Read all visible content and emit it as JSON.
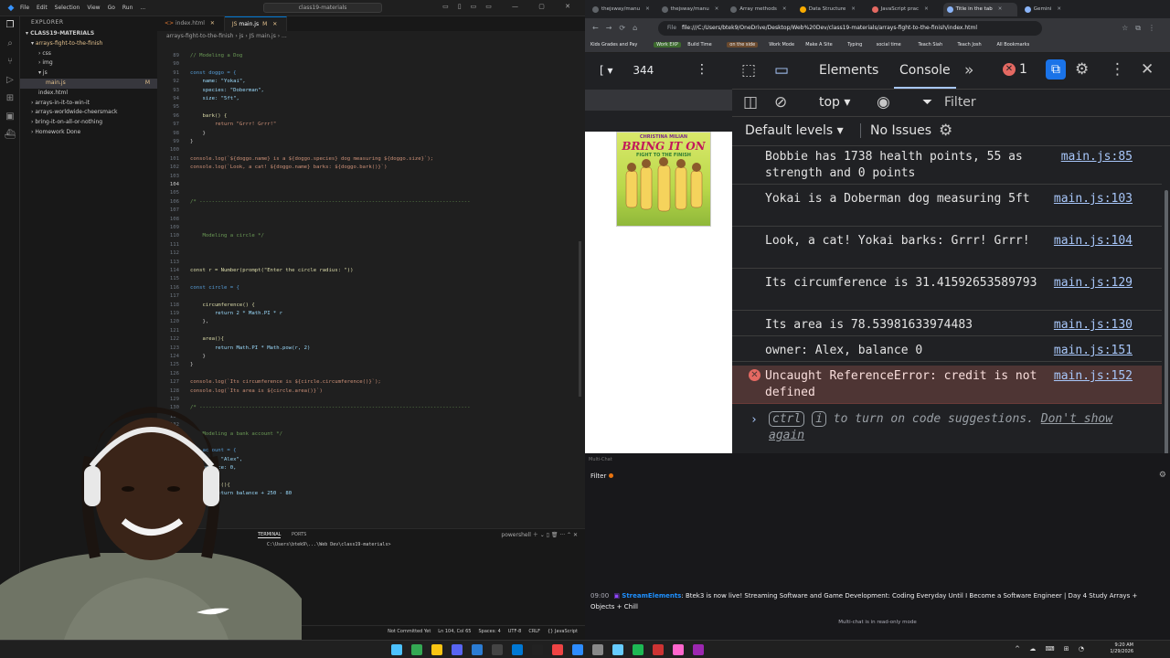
{
  "vscode": {
    "menu": [
      "File",
      "Edit",
      "Selection",
      "View",
      "Go",
      "Run",
      "..."
    ],
    "search": "class19-materials",
    "explorer_title": "EXPLORER",
    "root_folder": "CLASS19-MATERIALS",
    "tree": [
      {
        "label": "arrays-fight-to-the-finish",
        "indent": 1,
        "icon": "▾",
        "color": "#e2c08d"
      },
      {
        "label": "css",
        "indent": 2,
        "icon": "›",
        "color": "#ccc"
      },
      {
        "label": "img",
        "indent": 2,
        "icon": "›",
        "color": "#ccc"
      },
      {
        "label": "js",
        "indent": 2,
        "icon": "▾",
        "color": "#ccc"
      },
      {
        "label": "main.js",
        "indent": 3,
        "icon": "",
        "color": "#e2c08d",
        "selected": true,
        "mark": "M"
      },
      {
        "label": "index.html",
        "indent": 2,
        "icon": "",
        "color": "#ccc"
      },
      {
        "label": "arrays-in-it-to-win-it",
        "indent": 1,
        "icon": "›",
        "color": "#ccc"
      },
      {
        "label": "arrays-worldwide-cheersmack",
        "indent": 1,
        "icon": "›",
        "color": "#ccc"
      },
      {
        "label": "bring-it-on-all-or-nothing",
        "indent": 1,
        "icon": "›",
        "color": "#ccc"
      },
      {
        "label": "Homework Done",
        "indent": 1,
        "icon": "›",
        "color": "#ccc"
      }
    ],
    "tabs": [
      {
        "label": "index.html",
        "active": false,
        "mark": ""
      },
      {
        "label": "main.js",
        "active": true,
        "mark": "M"
      }
    ],
    "breadcrumb": "arrays-fight-to-the-finish › js › JS main.js › ...",
    "code": [
      {
        "n": "89",
        "t": "// Modeling a Dog",
        "c": "c-comment"
      },
      {
        "n": "90",
        "t": "",
        "c": ""
      },
      {
        "n": "91",
        "t": "const doggo = {",
        "c": "c-kw"
      },
      {
        "n": "92",
        "t": "    name: \"Yokai\",",
        "c": "c-prop"
      },
      {
        "n": "93",
        "t": "    species: \"Doberman\",",
        "c": "c-prop"
      },
      {
        "n": "94",
        "t": "    size: \"5ft\",",
        "c": "c-prop"
      },
      {
        "n": "95",
        "t": "",
        "c": ""
      },
      {
        "n": "96",
        "t": "    bark() {",
        "c": "c-fn"
      },
      {
        "n": "97",
        "t": "        return \"Grrr! Grrr!\"",
        "c": "c-str"
      },
      {
        "n": "98",
        "t": "    }",
        "c": ""
      },
      {
        "n": "99",
        "t": "}",
        "c": ""
      },
      {
        "n": "100",
        "t": "",
        "c": ""
      },
      {
        "n": "101",
        "t": "console.log(`${doggo.name} is a ${doggo.species} dog measuring ${doggo.size}`);",
        "c": "c-str"
      },
      {
        "n": "102",
        "t": "console.log(`Look, a cat! ${doggo.name} barks: ${doggo.bark()}`)",
        "c": "c-str"
      },
      {
        "n": "103",
        "t": "",
        "c": ""
      },
      {
        "n": "104",
        "t": "",
        "c": ""
      },
      {
        "n": "105",
        "t": "",
        "c": ""
      },
      {
        "n": "106",
        "t": "/* ----------------------------------------------------------------------------------------",
        "c": "c-comment"
      },
      {
        "n": "107",
        "t": "",
        "c": ""
      },
      {
        "n": "108",
        "t": "",
        "c": ""
      },
      {
        "n": "109",
        "t": "",
        "c": ""
      },
      {
        "n": "110",
        "t": "    Modeling a circle */",
        "c": "c-comment"
      },
      {
        "n": "111",
        "t": "",
        "c": ""
      },
      {
        "n": "112",
        "t": "",
        "c": ""
      },
      {
        "n": "113",
        "t": "",
        "c": ""
      },
      {
        "n": "114",
        "t": "const r = Number(prompt(\"Enter the circle radius: \"))",
        "c": "c-fn"
      },
      {
        "n": "115",
        "t": "",
        "c": ""
      },
      {
        "n": "116",
        "t": "const circle = {",
        "c": "c-kw"
      },
      {
        "n": "117",
        "t": "",
        "c": ""
      },
      {
        "n": "118",
        "t": "    circumference() {",
        "c": "c-fn"
      },
      {
        "n": "119",
        "t": "        return 2 * Math.PI * r",
        "c": "c-prop"
      },
      {
        "n": "120",
        "t": "    },",
        "c": ""
      },
      {
        "n": "121",
        "t": "",
        "c": ""
      },
      {
        "n": "122",
        "t": "    area(){",
        "c": "c-fn"
      },
      {
        "n": "123",
        "t": "        return Math.PI * Math.pow(r, 2)",
        "c": "c-prop"
      },
      {
        "n": "124",
        "t": "    }",
        "c": ""
      },
      {
        "n": "125",
        "t": "}",
        "c": ""
      },
      {
        "n": "126",
        "t": "",
        "c": ""
      },
      {
        "n": "127",
        "t": "console.log(`Its circumference is ${circle.circumference()}`);",
        "c": "c-str"
      },
      {
        "n": "128",
        "t": "console.log(`Its area is ${circle.area()}`)",
        "c": "c-str"
      },
      {
        "n": "129",
        "t": "",
        "c": ""
      },
      {
        "n": "130",
        "t": "/* ----------------------------------------------------------------------------------------",
        "c": "c-comment"
      },
      {
        "n": "131",
        "t": "",
        "c": ""
      },
      {
        "n": "132",
        "t": "",
        "c": ""
      },
      {
        "n": "133",
        "t": "    Modeling a bank account */",
        "c": "c-comment"
      },
      {
        "n": "134",
        "t": "",
        "c": ""
      },
      {
        "n": "135",
        "t": "    account = {",
        "c": "c-kw"
      },
      {
        "n": "136",
        "t": "    name: \"Alex\",",
        "c": "c-prop"
      },
      {
        "n": "137",
        "t": "    balance: 0,",
        "c": "c-prop"
      },
      {
        "n": "138",
        "t": "",
        "c": ""
      },
      {
        "n": "139",
        "t": "    credit(){",
        "c": "c-fn"
      },
      {
        "n": "140",
        "t": "        return balance + 250 - 80",
        "c": "c-prop"
      }
    ],
    "panel_tabs": [
      "TERMINAL",
      "PORTS"
    ],
    "panel_shell": "powershell",
    "terminal_line": "C:\\Users\\btek9\\...\\Web Dev\\class19-materials>",
    "status_right": [
      "Not Committed Yet",
      "Ln 104, Col 65",
      "Spaces: 4",
      "UTF-8",
      "CRLF",
      "{} JavaScript"
    ]
  },
  "chrome": {
    "tabs": [
      {
        "label": "thejsway/manu",
        "color": "#5f6368"
      },
      {
        "label": "thejsway/manu",
        "color": "#5f6368"
      },
      {
        "label": "Array methods",
        "color": "#5f6368"
      },
      {
        "label": "Data Structure",
        "color": "#f9ab00"
      },
      {
        "label": "JavaScript prac",
        "color": "#e46962"
      },
      {
        "label": "Title in the tab",
        "color": "#8ab4f8",
        "active": true
      },
      {
        "label": "Gemini",
        "color": "#8ab4f8"
      }
    ],
    "url_scheme": "File",
    "url": "file:///C:/Users/btek9/OneDrive/Desktop/Web%20Dev/class19-materials/arrays-fight-to-the-finish/index.html",
    "bookmarks": [
      {
        "label": "Kids Grades and Pay",
        "style": ""
      },
      {
        "label": "Work EXP",
        "style": "hl"
      },
      {
        "label": "Build Time",
        "style": ""
      },
      {
        "label": "on the side",
        "style": "hl2"
      },
      {
        "label": "Work Mode",
        "style": ""
      },
      {
        "label": "Make A Site",
        "style": ""
      },
      {
        "label": "Typing",
        "style": ""
      },
      {
        "label": "social time",
        "style": ""
      },
      {
        "label": "Teach Siah",
        "style": ""
      },
      {
        "label": "Teach Josh",
        "style": ""
      },
      {
        "label": "All Bookmarks",
        "style": ""
      }
    ],
    "viewport_width": "344",
    "poster": {
      "line1": "CHRISTINA MILIAN",
      "line2": "BRING IT ON",
      "line3": "FIGHT TO THE FINISH"
    }
  },
  "devtools": {
    "tabs": [
      "Elements",
      "Console"
    ],
    "error_count": "1",
    "context": "top",
    "filter_placeholder": "Filter",
    "levels": "Default levels",
    "issues": "No Issues",
    "messages": [
      {
        "text": "Bobbie has 1738 health points, 55 as strength and 0 points",
        "src": "main.js:85",
        "type": "log"
      },
      {
        "text": "Yokai is a Doberman dog measuring 5ft",
        "src": "main.js:103",
        "type": "log"
      },
      {
        "text": "Look, a cat! Yokai barks: Grrr! Grrr!",
        "src": "main.js:104",
        "type": "log"
      },
      {
        "text": "Its circumference is 31.41592653589793",
        "src": "main.js:129",
        "type": "log"
      },
      {
        "text": "Its area is 78.53981633974483",
        "src": "main.js:130",
        "type": "log"
      },
      {
        "text": "owner: Alex, balance 0",
        "src": "main.js:151",
        "type": "log"
      },
      {
        "text": "Uncaught ReferenceError: credit is not defined",
        "src": "main.js:152",
        "type": "error"
      }
    ],
    "hint_key1": "ctrl",
    "hint_key2": "i",
    "hint_text": "to turn on code suggestions.",
    "hint_link": "Don't show again"
  },
  "chat": {
    "title": "Multi-Chat",
    "filter": "Filter",
    "message": {
      "time": "09:00",
      "user": "StreamElements",
      "text": "Btek3 is now live! Streaming Software and Game Development: Coding Everyday Until I Become a Software Engineer | Day 4 Study Arrays + Objects + Chill"
    },
    "readonly": "Multi-chat is in read-only mode"
  },
  "taskbar": {
    "time": "9:20 AM",
    "date": "1/29/2026"
  }
}
